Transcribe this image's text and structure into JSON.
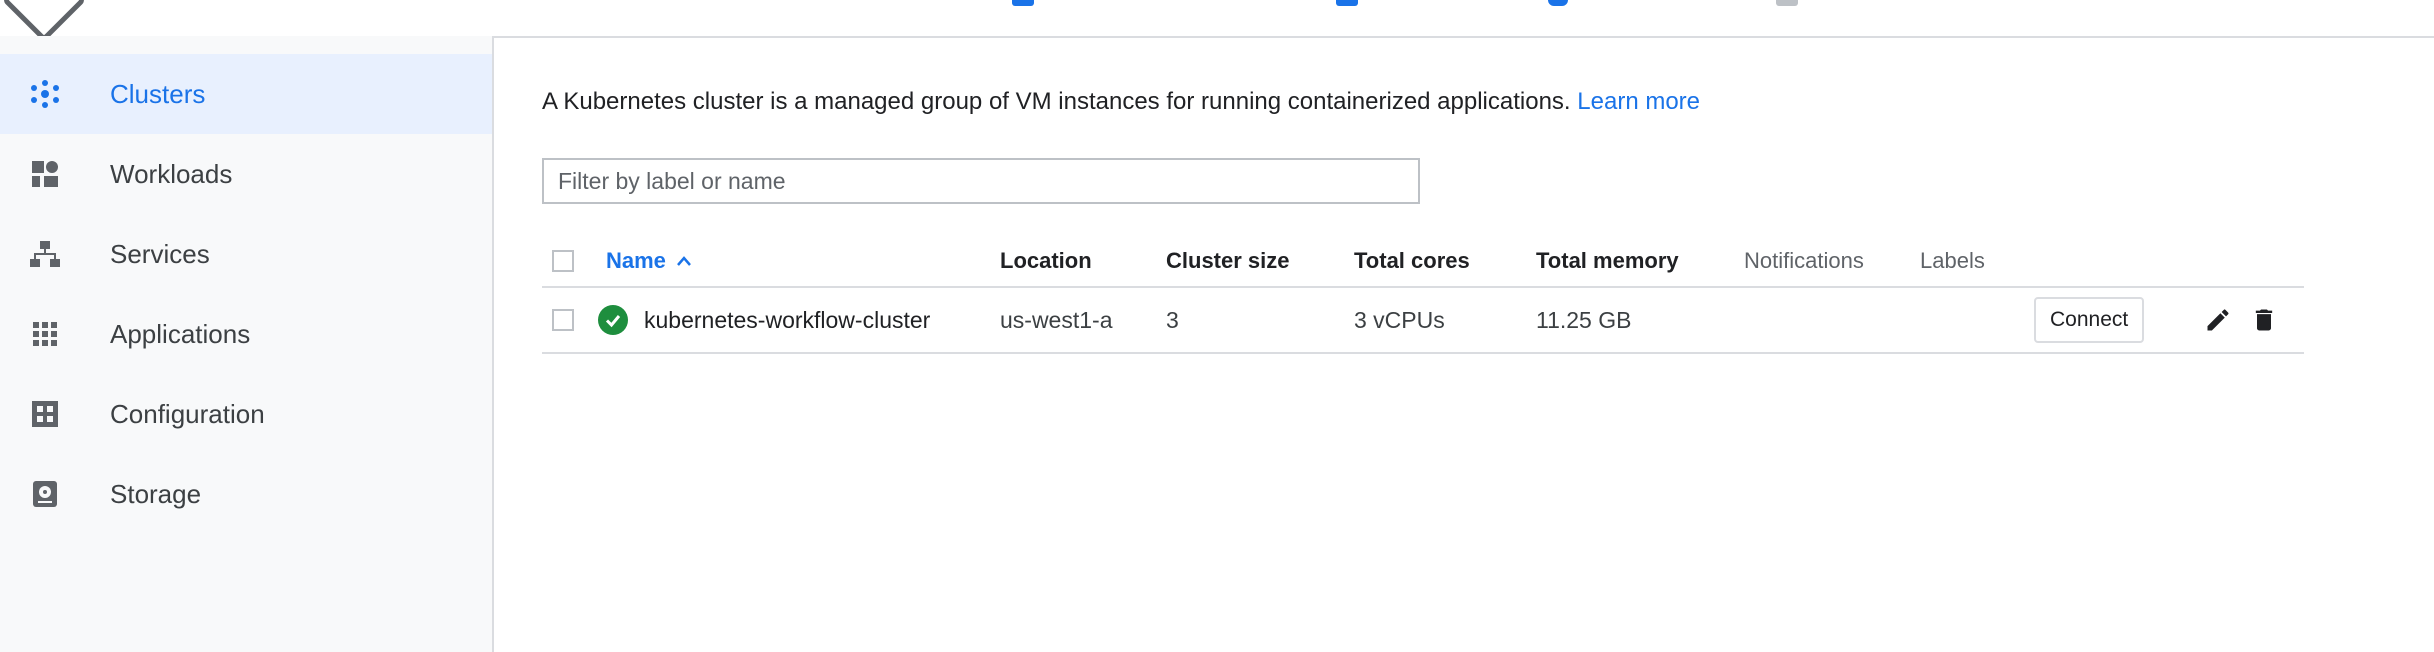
{
  "sidebar": {
    "items": [
      {
        "label": "Clusters",
        "icon": "clusters-icon",
        "active": true
      },
      {
        "label": "Workloads",
        "icon": "workloads-icon"
      },
      {
        "label": "Services",
        "icon": "services-icon"
      },
      {
        "label": "Applications",
        "icon": "applications-icon"
      },
      {
        "label": "Configuration",
        "icon": "configuration-icon"
      },
      {
        "label": "Storage",
        "icon": "storage-icon"
      }
    ]
  },
  "main": {
    "description": "A Kubernetes cluster is a managed group of VM instances for running containerized applications.",
    "learn_more": "Learn more",
    "filter_placeholder": "Filter by label or name"
  },
  "table": {
    "headers": {
      "name": "Name",
      "name_sort_icon": "sort-ascending-icon",
      "location": "Location",
      "cluster_size": "Cluster size",
      "total_cores": "Total cores",
      "total_memory": "Total memory",
      "notifications": "Notifications",
      "labels": "Labels"
    },
    "rows": [
      {
        "status": "ok",
        "name": "kubernetes-workflow-cluster",
        "location": "us-west1-a",
        "cluster_size": "3",
        "total_cores": "3 vCPUs",
        "total_memory": "11.25 GB",
        "action": "Connect"
      }
    ]
  },
  "colors": {
    "accent": "#1a73e8",
    "status_ok": "#1e8e3e",
    "active_bg": "#e8f0fe"
  }
}
